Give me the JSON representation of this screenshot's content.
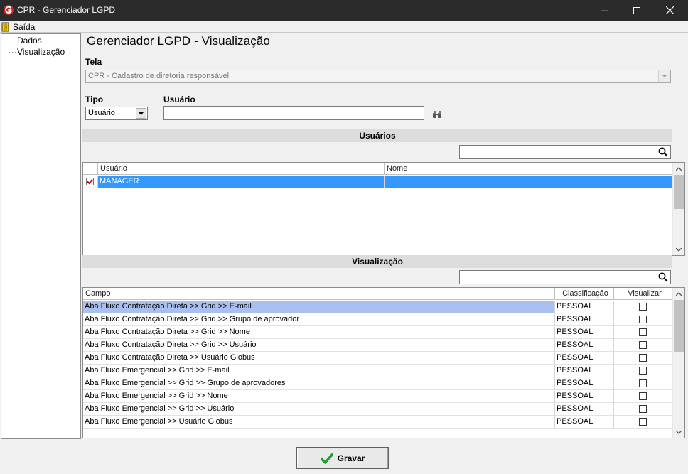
{
  "window": {
    "title": "CPR - Gerenciador LGPD",
    "icons": {
      "logo": "app-logo-icon",
      "minimize": "minimize-icon",
      "maximize": "maximize-icon",
      "close": "close-icon"
    }
  },
  "menu": {
    "items": [
      {
        "label": "Saída",
        "icon": "exit-door-icon"
      }
    ]
  },
  "tree": {
    "items": [
      {
        "label": "Dados"
      },
      {
        "label": "Visualização"
      }
    ]
  },
  "main": {
    "title": "Gerenciador LGPD - Visualização",
    "tela": {
      "label": "Tela",
      "value": "CPR - Cadastro de diretoria responsável"
    },
    "tipo": {
      "label": "Tipo",
      "value": "Usuário"
    },
    "usuario": {
      "label": "Usuário",
      "value": "",
      "icon": "binoculars-icon"
    }
  },
  "usuarios": {
    "section_title": "Usuários",
    "search_value": "",
    "columns": [
      "Usuário",
      "Nome"
    ],
    "rows": [
      {
        "checked": true,
        "usuario": "MANAGER",
        "nome": ""
      }
    ]
  },
  "visualizacao": {
    "section_title": "Visualização",
    "search_value": "",
    "columns": [
      "Campo",
      "Classificação",
      "Visualizar"
    ],
    "rows": [
      {
        "campo": "Aba Fluxo Contratação Direta >> Grid >> E-mail",
        "classificacao": "PESSOAL",
        "visualizar": false
      },
      {
        "campo": "Aba Fluxo Contratação Direta >> Grid >> Grupo de aprovador",
        "classificacao": "PESSOAL",
        "visualizar": false
      },
      {
        "campo": "Aba Fluxo Contratação Direta >> Grid >> Nome",
        "classificacao": "PESSOAL",
        "visualizar": false
      },
      {
        "campo": "Aba Fluxo Contratação Direta >> Grid >> Usuário",
        "classificacao": "PESSOAL",
        "visualizar": false
      },
      {
        "campo": "Aba Fluxo Contratação Direta >> Usuário Globus",
        "classificacao": "PESSOAL",
        "visualizar": false
      },
      {
        "campo": "Aba Fluxo Emergencial >> Grid >> E-mail",
        "classificacao": "PESSOAL",
        "visualizar": false
      },
      {
        "campo": "Aba Fluxo Emergencial >> Grid >> Grupo de aprovadores",
        "classificacao": "PESSOAL",
        "visualizar": false
      },
      {
        "campo": "Aba Fluxo Emergencial >> Grid >> Nome",
        "classificacao": "PESSOAL",
        "visualizar": false
      },
      {
        "campo": "Aba Fluxo Emergencial >> Grid >> Usuário",
        "classificacao": "PESSOAL",
        "visualizar": false
      },
      {
        "campo": "Aba Fluxo Emergencial >> Usuário Globus",
        "classificacao": "PESSOAL",
        "visualizar": false
      }
    ]
  },
  "footer": {
    "save_label": "Gravar",
    "save_icon": "checkmark-icon"
  },
  "colors": {
    "selection_blue": "#3399ff",
    "selection_light": "#a9bff0",
    "checkmark_green": "#1e9e2e",
    "titlebar": "#2b2b2b"
  }
}
